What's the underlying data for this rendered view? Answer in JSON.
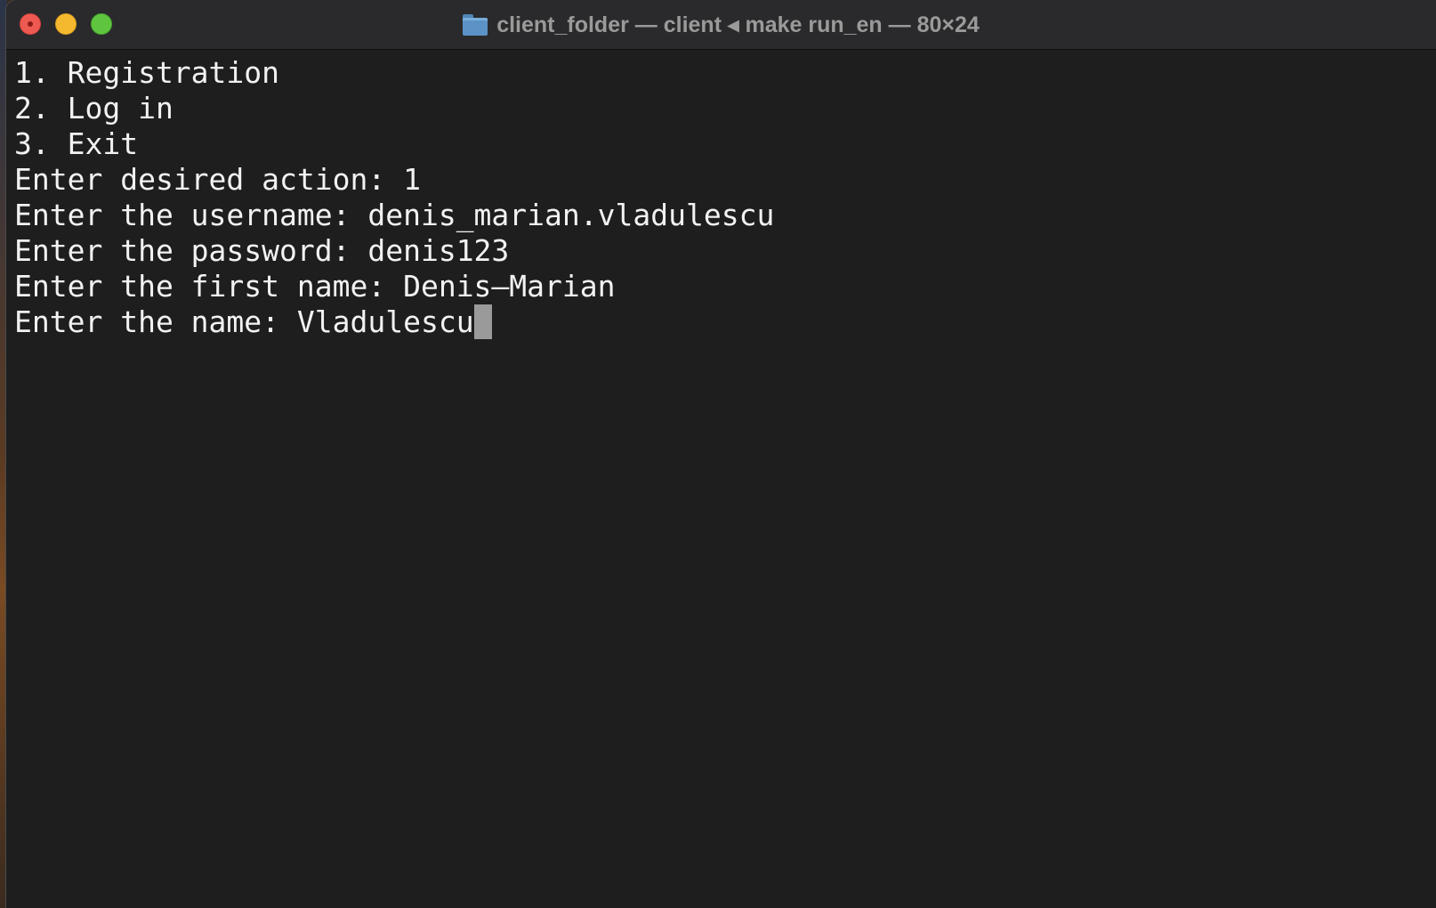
{
  "window": {
    "title": "client_folder — client ◂ make run_en — 80×24"
  },
  "terminal": {
    "lines": [
      "1. Registration",
      "2. Log in",
      "3. Exit",
      "Enter desired action: 1",
      "Enter the username: denis_marian.vladulescu",
      "Enter the password: denis123",
      "Enter the first name: Denis—Marian",
      "Enter the name: Vladulescu"
    ]
  },
  "colors": {
    "background": "#1e1e1e",
    "titlebar": "#2a2a2c",
    "text": "#f2f2f2",
    "cursor": "#9a9a9a",
    "close": "#ee5a52",
    "minimize": "#f5b930",
    "maximize": "#5fc53f"
  },
  "icons": {
    "title": "folder-icon"
  }
}
